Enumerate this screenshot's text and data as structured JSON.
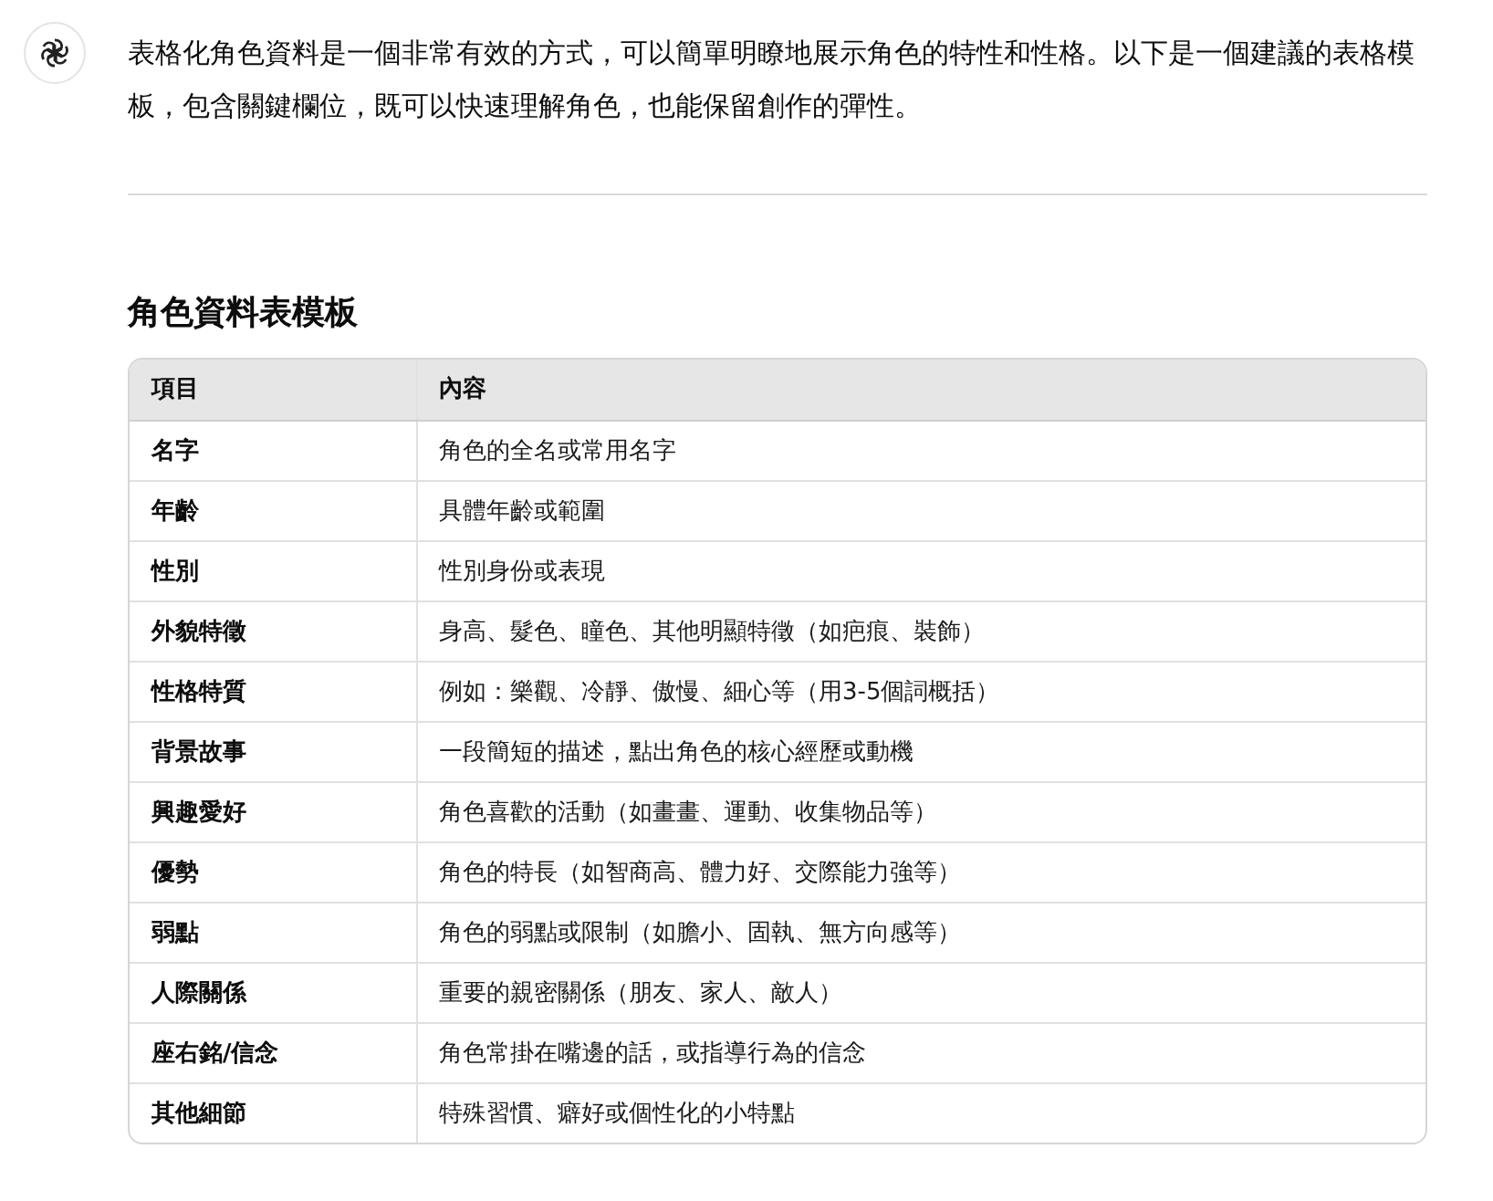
{
  "message": {
    "paragraph": "表格化角色資料是一個非常有效的方式，可以簡單明瞭地展示角色的特性和性格。以下是一個建議的表格模板，包含關鍵欄位，既可以快速理解角色，也能保留創作的彈性。"
  },
  "section_heading": "角色資料表模板",
  "table": {
    "columns": [
      "項目",
      "內容"
    ],
    "rows": [
      [
        "名字",
        "角色的全名或常用名字"
      ],
      [
        "年齡",
        "具體年齡或範圍"
      ],
      [
        "性別",
        "性別身份或表現"
      ],
      [
        "外貌特徵",
        "身高、髮色、瞳色、其他明顯特徵（如疤痕、裝飾）"
      ],
      [
        "性格特質",
        "例如：樂觀、冷靜、傲慢、細心等（用3-5個詞概括）"
      ],
      [
        "背景故事",
        "一段簡短的描述，點出角色的核心經歷或動機"
      ],
      [
        "興趣愛好",
        "角色喜歡的活動（如畫畫、運動、收集物品等）"
      ],
      [
        "優勢",
        "角色的特長（如智商高、體力好、交際能力強等）"
      ],
      [
        "弱點",
        "角色的弱點或限制（如膽小、固執、無方向感等）"
      ],
      [
        "人際關係",
        "重要的親密關係（朋友、家人、敵人）"
      ],
      [
        "座右銘/信念",
        "角色常掛在嘴邊的話，或指導行為的信念"
      ],
      [
        "其他細節",
        "特殊習慣、癖好或個性化的小特點"
      ]
    ]
  }
}
